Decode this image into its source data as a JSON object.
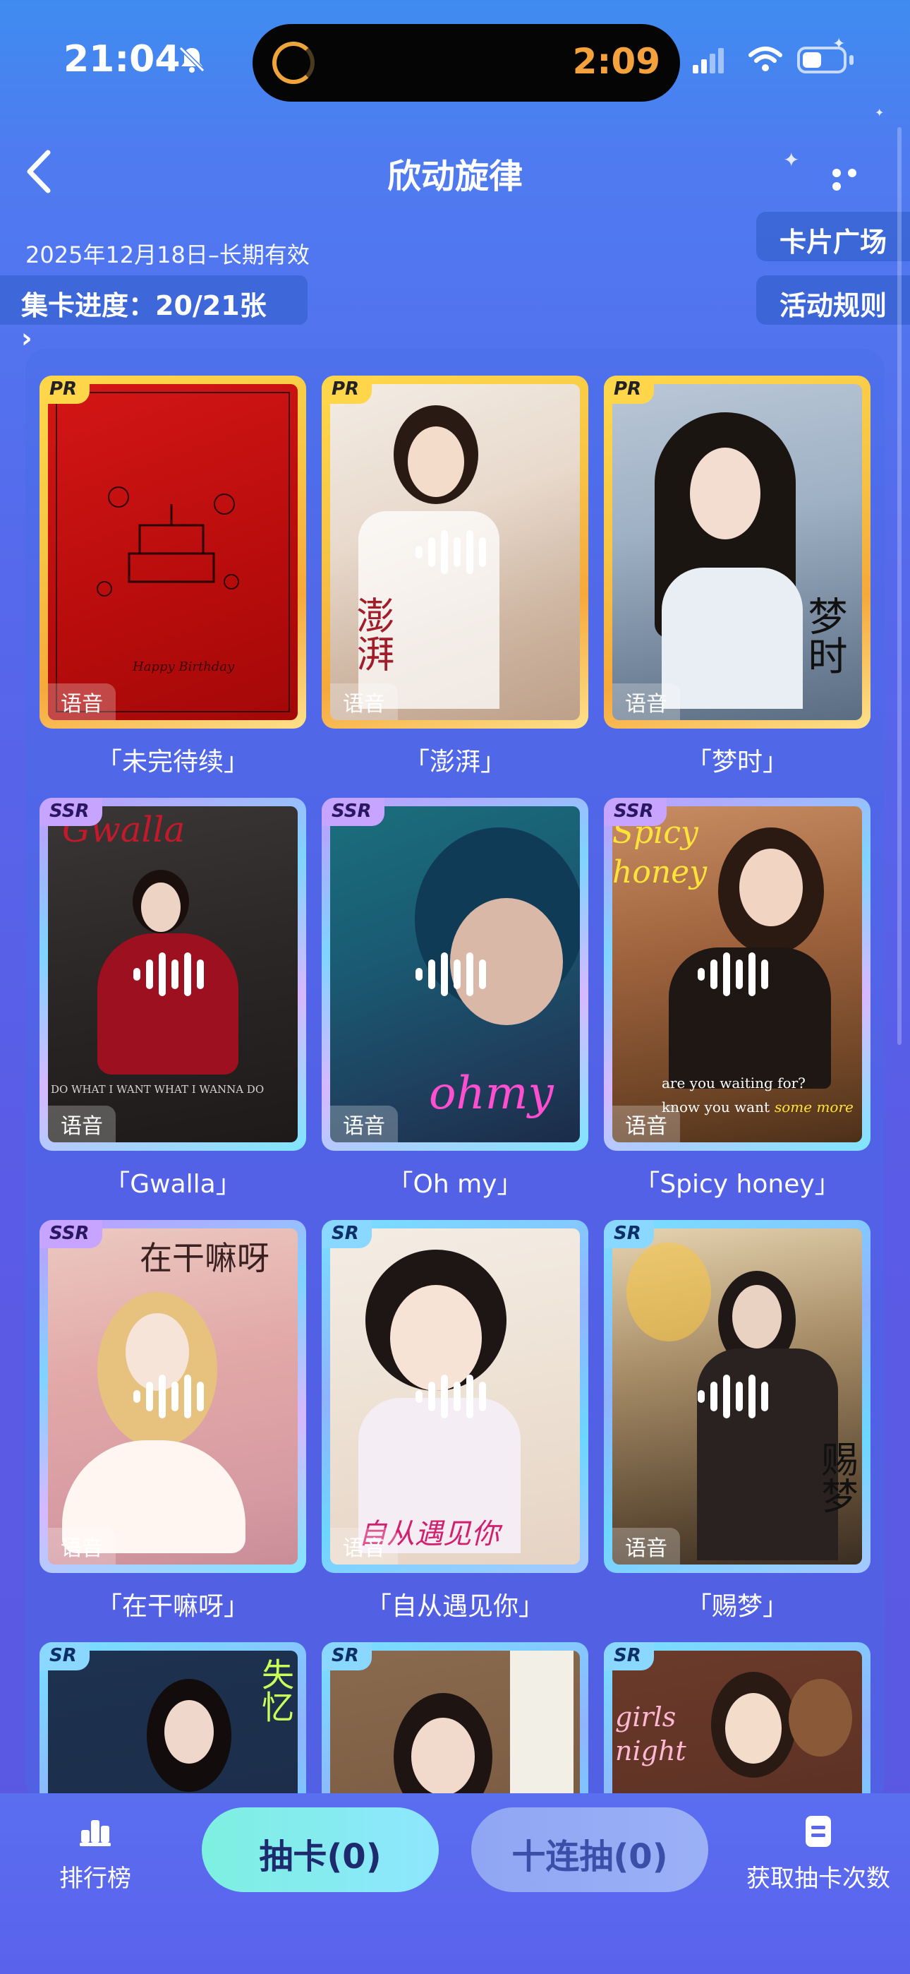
{
  "status_bar": {
    "time": "21:04",
    "timer": "2:09"
  },
  "header": {
    "title": "欣动旋律"
  },
  "info": {
    "date_range": "2025年12月18日–长期有效",
    "collection_progress": "集卡进度：20/21张 ›"
  },
  "side_buttons": {
    "card_square": "卡片广场",
    "rules": "活动规则"
  },
  "cards": [
    {
      "name": "「未完待续」",
      "rarity": "PR",
      "tag": "语音"
    },
    {
      "name": "「澎湃」",
      "rarity": "PR",
      "tag": "语音"
    },
    {
      "name": "「梦时」",
      "rarity": "PR",
      "tag": "语音"
    },
    {
      "name": "「Gwalla」",
      "rarity": "SSR",
      "tag": "语音"
    },
    {
      "name": "「Oh my」",
      "rarity": "SSR",
      "tag": "语音"
    },
    {
      "name": "「Spicy honey」",
      "rarity": "SSR",
      "tag": "语音"
    },
    {
      "name": "「在干嘛呀」",
      "rarity": "SSR",
      "tag": "语音"
    },
    {
      "name": "「自从遇见你」",
      "rarity": "SR",
      "tag": "语音"
    },
    {
      "name": "「赐梦」",
      "rarity": "SR",
      "tag": "语音"
    },
    {
      "name": "",
      "rarity": "SR",
      "tag": ""
    },
    {
      "name": "",
      "rarity": "SR",
      "tag": ""
    },
    {
      "name": "",
      "rarity": "SR",
      "tag": ""
    }
  ],
  "card_art_text": {
    "c2_a": "澎湃",
    "c3_a": "梦时",
    "c4_a": "Gwalla",
    "c4_b": "DO WHAT I WANT WHAT I WANNA DO",
    "c5_a": "ohmy",
    "c6_a": "Spicy honey",
    "c6_b": "are you waiting for?",
    "c6_c": "know you want",
    "c6_d": "some more",
    "c7_a": "在干嘛呀",
    "c8_a": "自从遇见你",
    "c9_a": "赐梦",
    "c10_a": "失忆",
    "c12_a": "girls night"
  },
  "bottom_bar": {
    "ranking": "排行榜",
    "draw": "抽卡(0)",
    "ten_draw": "十连抽(0)",
    "get_chances": "获取抽卡次数"
  },
  "colors": {
    "pr_frame": "#f7c544",
    "ssr_frame": "#c29bff",
    "sr_frame": "#77e0ff",
    "timer": "#f6a23c"
  }
}
